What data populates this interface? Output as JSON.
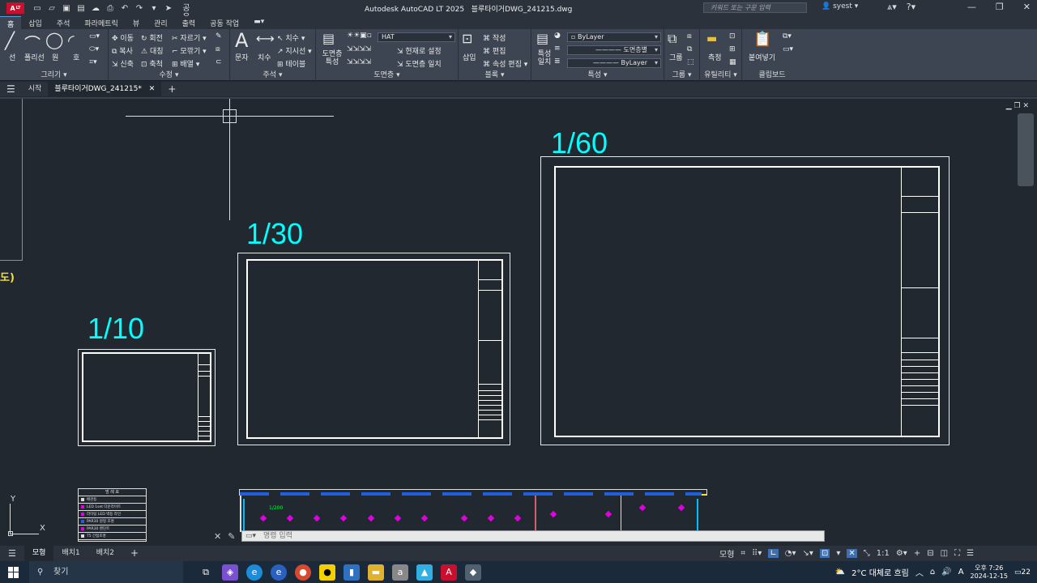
{
  "titlebar": {
    "logo": "A",
    "logo_sub": "LT",
    "share": "공유",
    "app_title": "Autodesk AutoCAD LT 2025",
    "file_title": "블루타이거DWG_241215.dwg",
    "search_placeholder": "키워드 또는 구문 입력",
    "user": "syest"
  },
  "ribbon_tabs": [
    "홈",
    "삽입",
    "주석",
    "파라메트릭",
    "뷰",
    "관리",
    "출력",
    "공동 작업"
  ],
  "ribbon": {
    "draw": {
      "title": "그리기",
      "line": "선",
      "polyline": "폴리선",
      "circle": "원",
      "arc": "호"
    },
    "modify": {
      "title": "수정",
      "move": "이동",
      "rotate": "회전",
      "trim": "자르기",
      "copy": "복사",
      "mirror": "대칭",
      "fillet": "모깎기",
      "stretch": "신축",
      "scale": "축척",
      "array": "배열"
    },
    "annotation": {
      "title": "주석",
      "text": "문자",
      "dimension": "치수",
      "leader": "지시선",
      "table": "테이블",
      "dim_linear": "치수"
    },
    "layers": {
      "title": "도면층",
      "props": "도면층 특성",
      "current_layer": "HAT",
      "set_current": "현재로 설정",
      "match": "도면층 일치"
    },
    "block": {
      "title": "블록",
      "insert": "삽입",
      "create": "작성",
      "edit": "편집",
      "attr_edit": "속성 편집"
    },
    "properties": {
      "title": "특성",
      "match": "특성 일치",
      "color": "ByLayer",
      "linetype": "도면층별",
      "lineweight": "ByLayer"
    },
    "groups": {
      "title": "그룹",
      "group": "그룹"
    },
    "utilities": {
      "title": "유틸리티",
      "measure": "측정"
    },
    "clipboard": {
      "title": "클립보드",
      "paste": "붙여넣기"
    }
  },
  "file_tabs": {
    "start": "시작",
    "active": "블루타이거DWG_241215*"
  },
  "drawing": {
    "left_text": "도)",
    "scales": [
      "1/10",
      "1/30",
      "1/60"
    ],
    "mini_title": "범 례 표",
    "legend": [
      "배관등",
      "LED 1set 다운라이트",
      "라이팅 LED 벽등 라인",
      "PAR30 원형 조명",
      "PAR30 펜던트",
      "T5 간접조명"
    ],
    "plan_label": "1/200",
    "ucs_y": "Y",
    "ucs_x": "X"
  },
  "command": {
    "placeholder": "명령 입력"
  },
  "layout_tabs": [
    "모형",
    "배치1",
    "배치2"
  ],
  "status": {
    "model": "모형",
    "scale": "1:1"
  },
  "taskbar": {
    "search": "찾기",
    "weather": "2°C  대체로 흐림",
    "time": "오후 7:26",
    "date": "2024-12-15",
    "notif": "22"
  }
}
